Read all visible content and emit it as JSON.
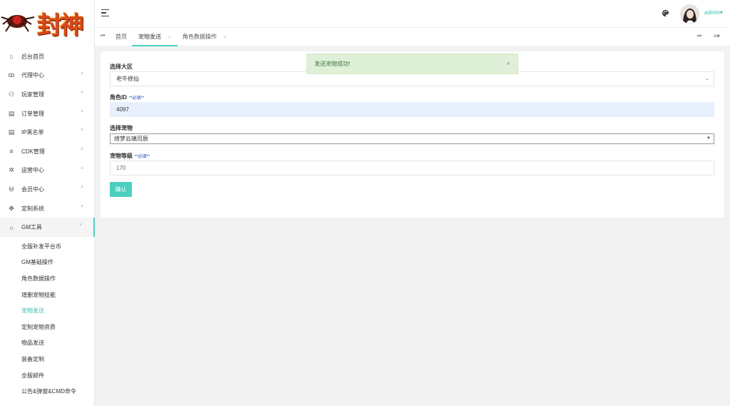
{
  "logo": {
    "text": "封神"
  },
  "header": {
    "user_name": "admin",
    "user_caret": "▾",
    "avatar_icon": "user-avatar",
    "theme_icon": "palette-icon"
  },
  "sidebar": {
    "items": [
      {
        "label": "后台首页",
        "icon": "⌂",
        "has_arrow": false
      },
      {
        "label": "代理中心",
        "icon": "ꝏ",
        "has_arrow": true
      },
      {
        "label": "玩家管理",
        "icon": "⚇",
        "has_arrow": true
      },
      {
        "label": "订单管理",
        "icon": "▤",
        "has_arrow": true
      },
      {
        "label": "IP黑名单",
        "icon": "▤",
        "has_arrow": true
      },
      {
        "label": "CDK管理",
        "icon": "≡",
        "has_arrow": true
      },
      {
        "label": "运营中心",
        "icon": "✲",
        "has_arrow": true
      },
      {
        "label": "会员中心",
        "icon": "Ʉ",
        "has_arrow": true
      },
      {
        "label": "定制系统",
        "icon": "✥",
        "has_arrow": true
      },
      {
        "label": "GM工具",
        "icon": "☼",
        "has_arrow": true
      }
    ],
    "arrow_closed": "˄",
    "arrow_open": "˅",
    "sub_items": [
      "全服补发平台币",
      "GM基础操作",
      "角色数据操作",
      "增删宠物技能",
      "宠物发送",
      "定制宠物资质",
      "物品发送",
      "装备定制",
      "全服邮件",
      "公告&弹窗&CMD命令"
    ],
    "active_sub": 4
  },
  "tabs": {
    "prev_icon": "⏮",
    "next_icon": "⏭",
    "menu_icon": "≡▾",
    "close_icon": "×",
    "items": [
      "首页",
      "宠物发送",
      "角色数据操作"
    ],
    "active": 1
  },
  "form": {
    "region_label": "选择大区",
    "region_value": "老牛修仙",
    "region_chevron": "⌄",
    "role_label": "角色ID",
    "required_tag": "**必填**",
    "role_value": "4097",
    "pet_label": "选择宠物",
    "pet_value": "绮梦云璃司辰",
    "pet_dropdown": "▼",
    "level_label": "宠物等级",
    "level_value": "170",
    "confirm_label": "确认"
  },
  "toast": {
    "message": "发送宠物成功!",
    "close": "×"
  },
  "colors": {
    "accent": "#4bcfbf",
    "toast_bg": "#dff0d8",
    "toast_text": "#3c763d",
    "required": "#1a3fc8"
  }
}
